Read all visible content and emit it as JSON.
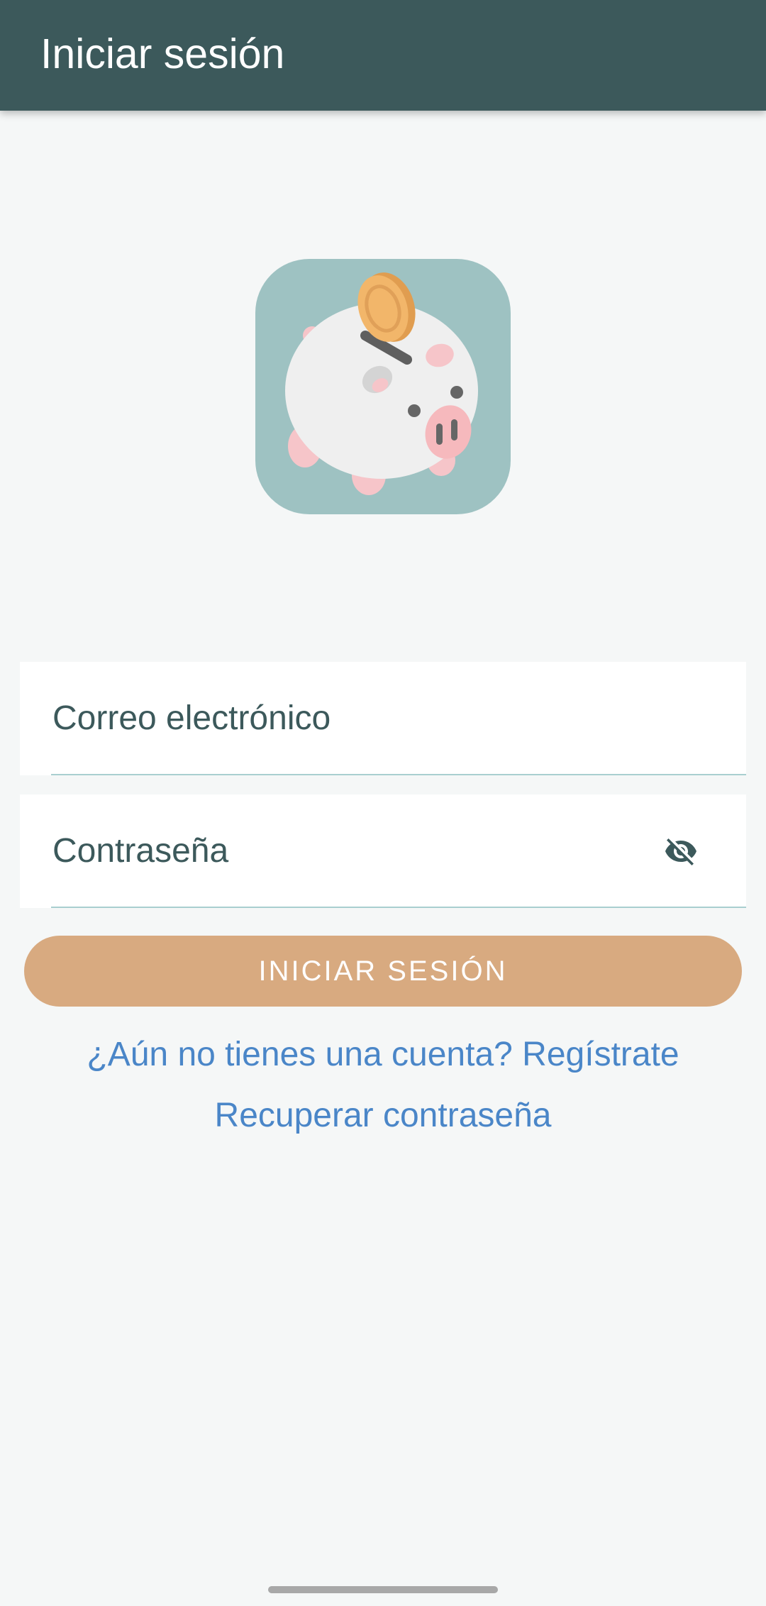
{
  "app_bar": {
    "title": "Iniciar sesión"
  },
  "logo": {
    "icon": "piggy-bank-with-coin-icon"
  },
  "form": {
    "email": {
      "label": "Correo electrónico",
      "value": ""
    },
    "password": {
      "label": "Contraseña",
      "value": "",
      "visibility_icon": "eye-off-icon"
    },
    "submit_label": "INICIAR SESIÓN"
  },
  "links": {
    "register": "¿Aún no tienes una cuenta? Regístrate",
    "recover": "Recuperar contraseña"
  },
  "colors": {
    "app_bar": "#3c595b",
    "button": "#d8aa80",
    "link": "#4a86c8",
    "logo_background": "#9ec2c2",
    "field_underline": "#a9cfd0"
  }
}
